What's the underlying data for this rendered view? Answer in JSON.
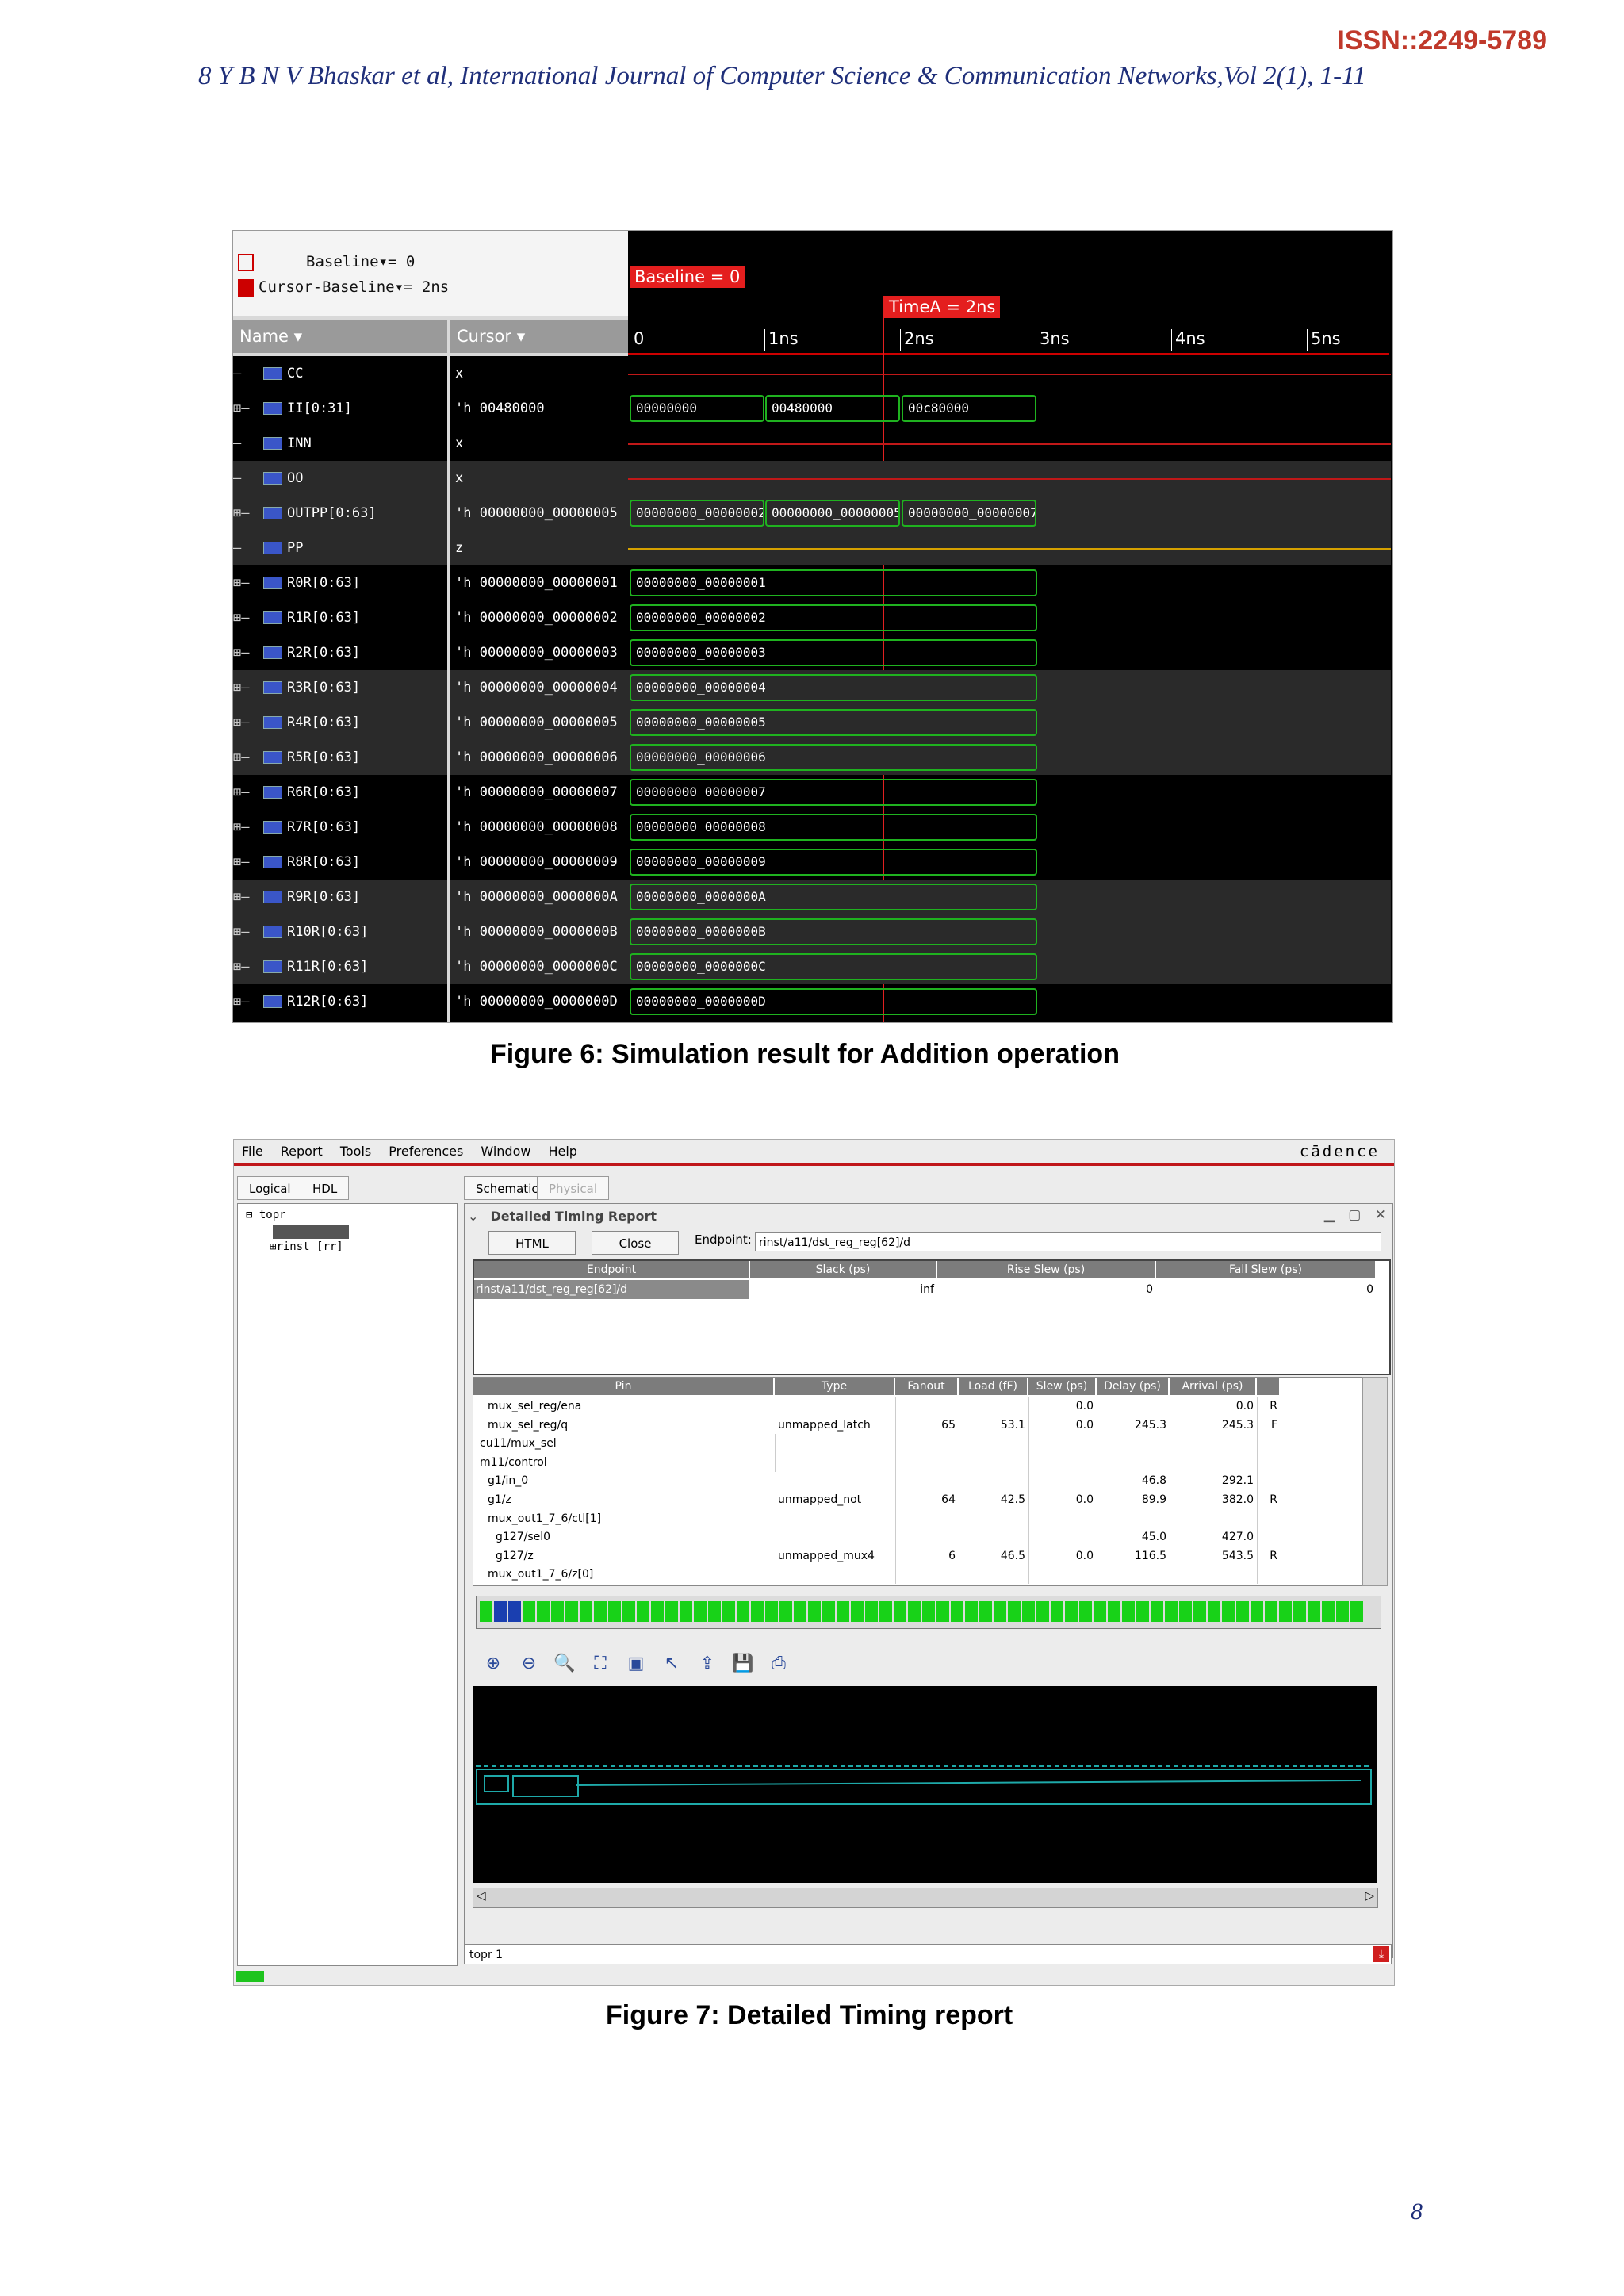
{
  "header": {
    "issn": "ISSN::2249-5789",
    "running_head": "8   Y B N V Bhaskar et al, International Journal of Computer Science & Communication Networks,Vol 2(1), 1-11"
  },
  "figure6": {
    "caption": "Figure 6:  Simulation result for Addition operation",
    "baseline_label": "Baseline▾= 0",
    "cursor_baseline_label": "Cursor-Baseline▾= 2ns",
    "name_header": "Name ▾",
    "cursor_header": "Cursor ▾",
    "baseline_tag": "Baseline = 0",
    "timea_tag": "TimeA = 2ns",
    "ticks": [
      "0",
      "1ns",
      "2ns",
      "3ns",
      "4ns",
      "5ns"
    ],
    "signals": [
      {
        "name": "CC",
        "cursor": "x"
      },
      {
        "name": "II[0:31]",
        "cursor": "'h 00480000"
      },
      {
        "name": "INN",
        "cursor": "x"
      },
      {
        "name": "OO",
        "cursor": "x"
      },
      {
        "name": "OUTPP[0:63]",
        "cursor": "'h 00000000_00000005"
      },
      {
        "name": "PP",
        "cursor": "z"
      },
      {
        "name": "R0R[0:63]",
        "cursor": "'h 00000000_00000001"
      },
      {
        "name": "R1R[0:63]",
        "cursor": "'h 00000000_00000002"
      },
      {
        "name": "R2R[0:63]",
        "cursor": "'h 00000000_00000003"
      },
      {
        "name": "R3R[0:63]",
        "cursor": "'h 00000000_00000004"
      },
      {
        "name": "R4R[0:63]",
        "cursor": "'h 00000000_00000005"
      },
      {
        "name": "R5R[0:63]",
        "cursor": "'h 00000000_00000006"
      },
      {
        "name": "R6R[0:63]",
        "cursor": "'h 00000000_00000007"
      },
      {
        "name": "R7R[0:63]",
        "cursor": "'h 00000000_00000008"
      },
      {
        "name": "R8R[0:63]",
        "cursor": "'h 00000000_00000009"
      },
      {
        "name": "R9R[0:63]",
        "cursor": "'h 00000000_0000000A"
      },
      {
        "name": "R10R[0:63]",
        "cursor": "'h 00000000_0000000B"
      },
      {
        "name": "R11R[0:63]",
        "cursor": "'h 00000000_0000000C"
      },
      {
        "name": "R12R[0:63]",
        "cursor": "'h 00000000_0000000D"
      }
    ],
    "ii_values": [
      "00000000",
      "00480000",
      "00c80000"
    ],
    "outpp_values": [
      "00000000_00000002",
      "00000000_00000005",
      "00000000_00000007"
    ],
    "register_values": [
      "00000000_00000001",
      "00000000_00000002",
      "00000000_00000003",
      "00000000_00000004",
      "00000000_00000005",
      "00000000_00000006",
      "00000000_00000007",
      "00000000_00000008",
      "00000000_00000009",
      "00000000_0000000A",
      "00000000_0000000B",
      "00000000_0000000C",
      "00000000_0000000D"
    ]
  },
  "figure7": {
    "caption": "Figure 7: Detailed Timing report",
    "menu": [
      "File",
      "Report",
      "Tools",
      "Preferences",
      "Window",
      "Help"
    ],
    "brand": "cādence",
    "left_tabs": [
      "Logical",
      "HDL"
    ],
    "right_tabs": [
      "Schematic",
      "Physical"
    ],
    "tree": {
      "root": "topr",
      "child": "rinst [rr]"
    },
    "panel_title": "Detailed Timing Report",
    "html_button": "HTML",
    "close_button": "Close",
    "endpoint_label": "Endpoint:",
    "endpoint_value": "rinst/a11/dst_reg_reg[62]/d",
    "endpoint_table": {
      "headers": [
        "Endpoint",
        "Slack (ps)",
        "Rise Slew (ps)",
        "Fall Slew (ps)"
      ],
      "row": [
        "rinst/a11/dst_reg_reg[62]/d",
        "inf",
        "0",
        "0"
      ]
    },
    "path_table": {
      "headers": [
        "Pin",
        "Type",
        "Fanout",
        "Load (fF)",
        "Slew (ps)",
        "Delay (ps)",
        "Arrival (ps)",
        ""
      ],
      "rows": [
        [
          "mux_sel_reg/ena",
          "",
          "",
          "",
          "0.0",
          "",
          "0.0",
          "R"
        ],
        [
          "mux_sel_reg/q",
          "unmapped_latch",
          "65",
          "53.1",
          "0.0",
          "245.3",
          "245.3",
          "F"
        ],
        [
          "cu11/mux_sel",
          "",
          "",
          "",
          "",
          "",
          "",
          ""
        ],
        [
          "m11/control",
          "",
          "",
          "",
          "",
          "",
          "",
          ""
        ],
        [
          "g1/in_0",
          "",
          "",
          "",
          "",
          "46.8",
          "292.1",
          ""
        ],
        [
          "g1/z",
          "unmapped_not",
          "64",
          "42.5",
          "0.0",
          "89.9",
          "382.0",
          "R"
        ],
        [
          "mux_out1_7_6/ctl[1]",
          "",
          "",
          "",
          "",
          "",
          "",
          ""
        ],
        [
          "g127/sel0",
          "",
          "",
          "",
          "",
          "45.0",
          "427.0",
          ""
        ],
        [
          "g127/z",
          "unmapped_mux4",
          "6",
          "46.5",
          "0.0",
          "116.5",
          "543.5",
          "R"
        ],
        [
          "mux_out1_7_6/z[0]",
          "",
          "",
          "",
          "",
          "",
          "",
          ""
        ]
      ]
    },
    "status_text": "topr 1"
  },
  "page_number": "8"
}
